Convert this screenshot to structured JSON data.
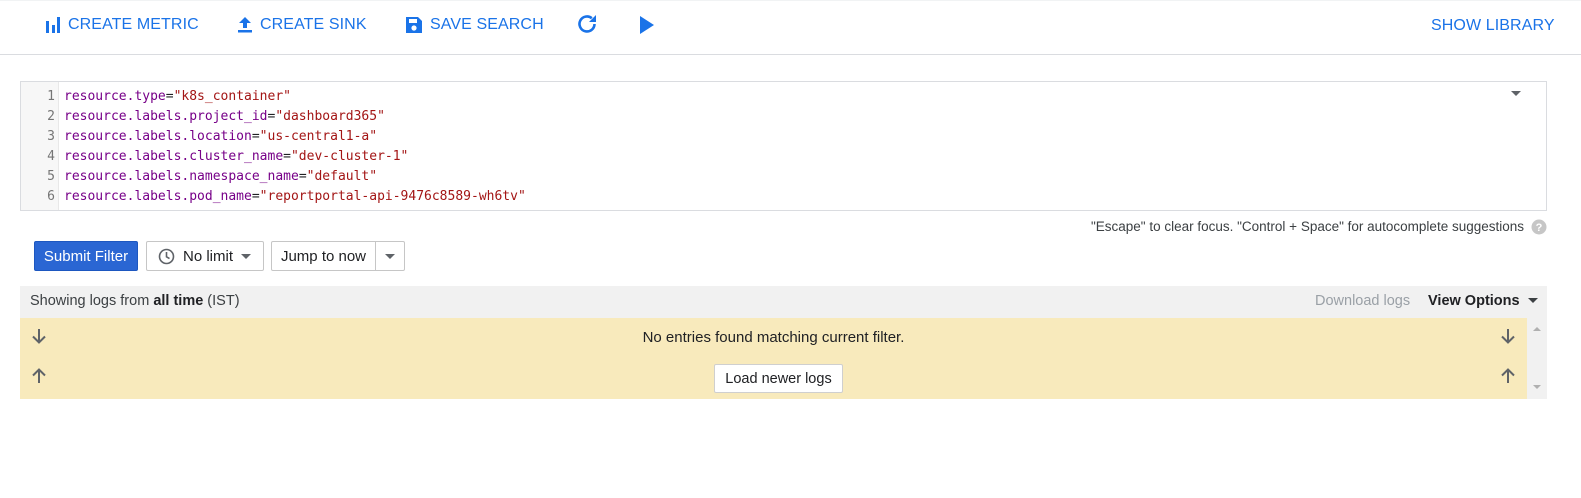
{
  "toolbar": {
    "create_metric": "CREATE METRIC",
    "create_sink": "CREATE SINK",
    "save_search": "SAVE SEARCH",
    "show_library": "SHOW LIBRARY",
    "icons": [
      "bar-chart-icon",
      "upload-icon",
      "save-icon",
      "refresh-icon",
      "play-icon"
    ],
    "accent_color": "#1a73e8"
  },
  "editor": {
    "lines": [
      {
        "n": "1",
        "key": "resource.type",
        "op": "=",
        "val": "\"k8s_container\""
      },
      {
        "n": "2",
        "key": "resource.labels.project_id",
        "op": "=",
        "val": "\"dashboard365\""
      },
      {
        "n": "3",
        "key": "resource.labels.location",
        "op": "=",
        "val": "\"us-central1-a\""
      },
      {
        "n": "4",
        "key": "resource.labels.cluster_name",
        "op": "=",
        "val": "\"dev-cluster-1\""
      },
      {
        "n": "5",
        "key": "resource.labels.namespace_name",
        "op": "=",
        "val": "\"default\""
      },
      {
        "n": "6",
        "key": "resource.labels.pod_name",
        "op": "=",
        "val": "\"reportportal-api-9476c8589-wh6tv\""
      }
    ],
    "hint": "\"Escape\" to clear focus. \"Control + Space\" for autocomplete suggestions"
  },
  "controls": {
    "submit": "Submit Filter",
    "limit": "No limit",
    "jump": "Jump to now"
  },
  "logs": {
    "showing_prefix": "Showing logs from ",
    "showing_range": "all time",
    "showing_suffix": " (IST)",
    "download": "Download logs",
    "view_options": "View Options",
    "empty_message": "No entries found matching current filter.",
    "load_newer": "Load newer logs",
    "panel_color": "#f8eabc"
  }
}
